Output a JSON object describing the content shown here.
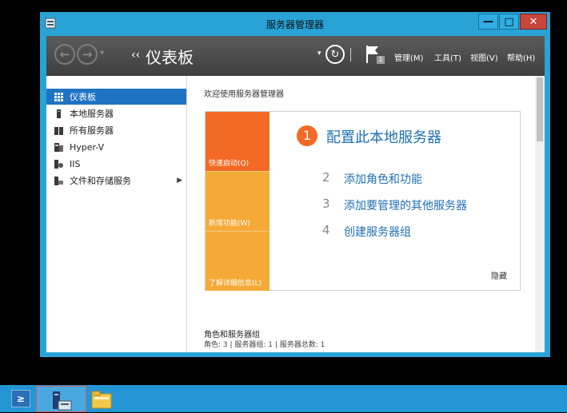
{
  "window": {
    "title": "服务器管理器",
    "min_glyph": "—",
    "max_glyph": "□",
    "close_glyph": "✕"
  },
  "toolbar": {
    "breadcrumb_arrow": "‹‹",
    "breadcrumb_title": "仪表板",
    "dropdown_glyph": "▾",
    "notification_count": "1",
    "menus": {
      "manage": "管理(M)",
      "tools": "工具(T)",
      "view": "视图(V)",
      "help": "帮助(H)"
    }
  },
  "nav": {
    "items": [
      {
        "label": "仪表板",
        "icon": "dashboard-icon",
        "selected": true
      },
      {
        "label": "本地服务器",
        "icon": "server-icon"
      },
      {
        "label": "所有服务器",
        "icon": "servers-icon"
      },
      {
        "label": "Hyper-V",
        "icon": "hyperv-icon"
      },
      {
        "label": "IIS",
        "icon": "iis-icon"
      },
      {
        "label": "文件和存储服务",
        "icon": "storage-icon",
        "has_submenu": true
      }
    ],
    "submenu_glyph": "▶"
  },
  "content": {
    "welcome": "欢迎使用服务器管理器",
    "tiles": {
      "quick_start": "快速启动(Q)",
      "whats_new": "新增功能(W)",
      "learn_more": "了解详细信息(L)"
    },
    "steps": [
      {
        "num": "1",
        "text": "配置此本地服务器"
      },
      {
        "num": "2",
        "text": "添加角色和功能"
      },
      {
        "num": "3",
        "text": "添加要管理的其他服务器"
      },
      {
        "num": "4",
        "text": "创建服务器组"
      }
    ],
    "hide": "隐藏",
    "roles_title": "角色和服务器组",
    "roles_summary": "角色: 3 | 服务器组: 1 | 服务器总数: 1"
  },
  "taskbar": {
    "powershell_glyph": "≥"
  },
  "colors": {
    "window_frame": "#29a3d6",
    "toolbar": "#4a4a4a",
    "selection": "#1e74c3",
    "tile_orange": "#f26a24",
    "tile_amber": "#f5aa38",
    "link_blue": "#1f6fb5",
    "taskbar": "#2495d4"
  }
}
